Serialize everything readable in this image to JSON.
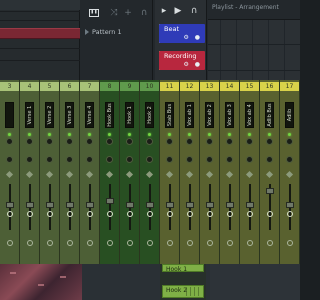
{
  "toolbar": {
    "piano_icon": "piano-keys-icon",
    "magnet_icon": "magnet-icon",
    "add_icon": "plus-icon",
    "play_icon": "play-icon",
    "snap_icon": "snap-icon"
  },
  "picker": {
    "pattern_label": "Pattern 1"
  },
  "playlist": {
    "header_text": "Playlist - Arrangement",
    "tracks": [
      {
        "name": "Beat",
        "color": "#2f3bb8"
      },
      {
        "name": "Recording",
        "color": "#b8273e"
      }
    ]
  },
  "mixer": {
    "strips": [
      {
        "num": "3",
        "name": "",
        "group": "green"
      },
      {
        "num": "4",
        "name": "Verse 1",
        "group": "green"
      },
      {
        "num": "5",
        "name": "Verse 2",
        "group": "green"
      },
      {
        "num": "6",
        "name": "Verse 3",
        "group": "green"
      },
      {
        "num": "7",
        "name": "Verse 4",
        "group": "green"
      },
      {
        "num": "8",
        "name": "Hook Bus",
        "group": "deepgreen"
      },
      {
        "num": "9",
        "name": "Hook 1",
        "group": "deepgreen"
      },
      {
        "num": "10",
        "name": "Hook 2",
        "group": "deepgreen"
      },
      {
        "num": "11",
        "name": "Stab Bus",
        "group": "yellow"
      },
      {
        "num": "12",
        "name": "Vox ab 1",
        "group": "yellow"
      },
      {
        "num": "13",
        "name": "Vox ab 2",
        "group": "yellow"
      },
      {
        "num": "14",
        "name": "Vox ab 3",
        "group": "yellow"
      },
      {
        "num": "15",
        "name": "Vox ab 4",
        "group": "yellow"
      },
      {
        "num": "16",
        "name": "Adlib Bus",
        "group": "yellow"
      },
      {
        "num": "17",
        "name": "Adlib",
        "group": "yellow"
      }
    ],
    "fader_levels": [
      0.55,
      0.55,
      0.55,
      0.55,
      0.55,
      0.65,
      0.55,
      0.55,
      0.55,
      0.55,
      0.55,
      0.55,
      0.55,
      0.9,
      0.55
    ]
  },
  "bottom": {
    "clips": [
      {
        "label": "Hook 1"
      },
      {
        "label": "Hook 2"
      }
    ]
  }
}
